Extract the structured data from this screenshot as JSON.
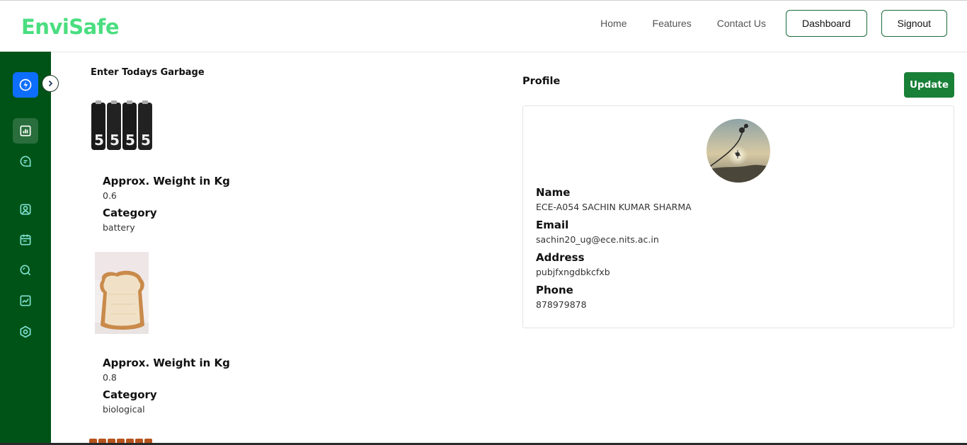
{
  "brand": {
    "name": "EnviSafe",
    "color": "#4ade80"
  },
  "colors": {
    "sidebar": "#005317",
    "primary_btn": "#0d6efd",
    "update_btn": "#198038",
    "icon_stroke": "#7fe0d0"
  },
  "nav": {
    "links": [
      "Home",
      "Features",
      "Contact Us"
    ],
    "dashboard_label": "Dashboard",
    "signout_label": "Signout"
  },
  "sidebar": {
    "primary_icon": "lightning-icon",
    "toggle_icon": "chevron-right-icon",
    "items": [
      {
        "icon": "bar-chart-icon",
        "active": true
      },
      {
        "icon": "chat-icon",
        "active": false
      },
      {
        "icon": "user-profile-icon",
        "active": false
      },
      {
        "icon": "calendar-icon",
        "active": false
      },
      {
        "icon": "search-icon",
        "active": false
      },
      {
        "icon": "line-chart-icon",
        "active": false
      },
      {
        "icon": "settings-hex-icon",
        "active": false
      }
    ]
  },
  "garbage": {
    "title": "Enter Todays Garbage",
    "items": [
      {
        "image": "batteries-image",
        "weight_label": "Approx. Weight in Kg",
        "weight": "0.6",
        "category_label": "Category",
        "category": "battery"
      },
      {
        "image": "bread-image",
        "weight_label": "Approx. Weight in Kg",
        "weight": "0.8",
        "category_label": "Category",
        "category": "biological"
      }
    ]
  },
  "profile": {
    "title": "Profile",
    "update_label": "Update",
    "name_label": "Name",
    "name": "ECE-A054 SACHIN KUMAR SHARMA",
    "email_label": "Email",
    "email": "sachin20_ug@ece.nits.ac.in",
    "address_label": "Address",
    "address": "pubjfxngdbkcfxb",
    "phone_label": "Phone",
    "phone": "878979878"
  }
}
